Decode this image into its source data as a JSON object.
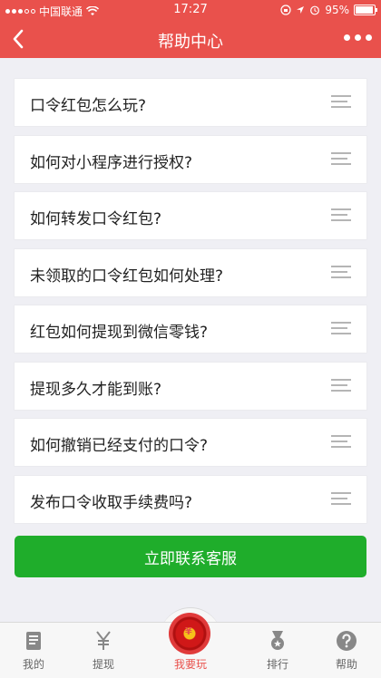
{
  "status_bar": {
    "carrier": "中国联通",
    "time": "17:27",
    "battery": "95%",
    "battery_level": 0.95
  },
  "nav": {
    "title": "帮助中心",
    "back_icon": "chevron-left-icon",
    "more_icon": "more-dots-icon"
  },
  "faq": {
    "items": [
      {
        "label": "口令红包怎么玩?"
      },
      {
        "label": "如何对小程序进行授权?"
      },
      {
        "label": "如何转发口令红包?"
      },
      {
        "label": "未领取的口令红包如何处理?"
      },
      {
        "label": "红包如何提现到微信零钱?"
      },
      {
        "label": "提现多久才能到账?"
      },
      {
        "label": "如何撤销已经支付的口令?"
      },
      {
        "label": "发布口令收取手续费吗?"
      }
    ]
  },
  "contact": {
    "label": "立即联系客服"
  },
  "tabs": [
    {
      "label": "我的",
      "icon": "document-icon"
    },
    {
      "label": "提现",
      "icon": "yen-icon"
    },
    {
      "label": "我要玩",
      "icon": "red-envelope-icon",
      "active": true
    },
    {
      "label": "排行",
      "icon": "medal-icon"
    },
    {
      "label": "帮助",
      "icon": "help-icon"
    }
  ],
  "colors": {
    "accent": "#e9514c",
    "button_green": "#1fad2b",
    "background": "#efeff4"
  }
}
